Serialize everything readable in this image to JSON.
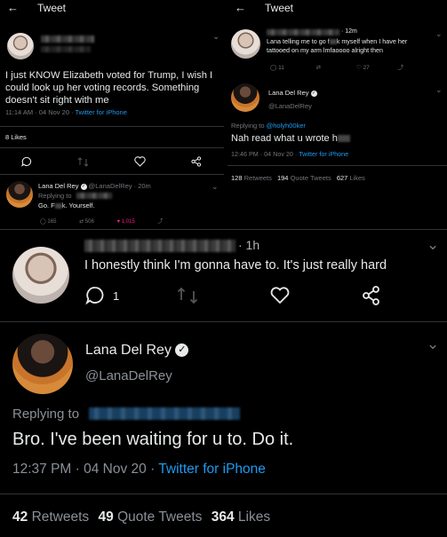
{
  "panel_left": {
    "header_title": "Tweet",
    "tweet_text": "I just KNOW Elizabeth voted for Trump, I wish I could look up her voting records. Something doesn't sit right with me",
    "time_line": "11:14 AM · 04 Nov 20 · ",
    "client": "Twitter for iPhone",
    "likes_line": "8 Likes",
    "reply_name": "Lana Del Rey",
    "reply_handle_time": "@LanaDelRey · 20m",
    "replying_to_label": "Replying to",
    "reply_text": "Go. F",
    "reply_text_end": "k. Yourself.",
    "reply_count": "165",
    "retweet_count": "506",
    "like_count": "1,015"
  },
  "panel_right": {
    "header_title": "Tweet",
    "time_ago": "· 12m",
    "tweet_text": "Lana telling me to go f",
    "tweet_text_end": "k myself when I have her tattooed on my arm lmfaoooo alright then",
    "reply_count": "11",
    "like_count": "27",
    "name": "Lana Del Rey",
    "handle": "@LanaDelRey",
    "replying_to": "Replying to ",
    "replying_to_user": "@holyh00ker",
    "main_text": "Nah read what u wrote h",
    "time_line": "12:46 PM · 04 Nov 20 · ",
    "client": "Twitter for iPhone",
    "retweets_num": "128",
    "retweets_label": "Retweets",
    "quotes_num": "194",
    "quotes_label": "Quote Tweets",
    "likes_num": "627",
    "likes_label": "Likes"
  },
  "bottom": {
    "time_ago": "· 1h",
    "reply_text": "I honestly think I'm gonna have to. It's just really hard",
    "reply_count": "1",
    "name": "Lana Del Rey",
    "handle": "@LanaDelRey",
    "replying_to": "Replying to",
    "main_text": "Bro. I've been waiting for u to. Do it.",
    "time_line": "12:37 PM · 04 Nov 20 · ",
    "client": "Twitter for iPhone",
    "retweets_num": "42",
    "retweets_label": "Retweets",
    "quotes_num": "49",
    "quotes_label": "Quote Tweets",
    "likes_num": "364",
    "likes_label": "Likes"
  },
  "colors": {
    "link": "#1d9bf0",
    "like_active": "#f91880",
    "muted": "#71767b"
  }
}
